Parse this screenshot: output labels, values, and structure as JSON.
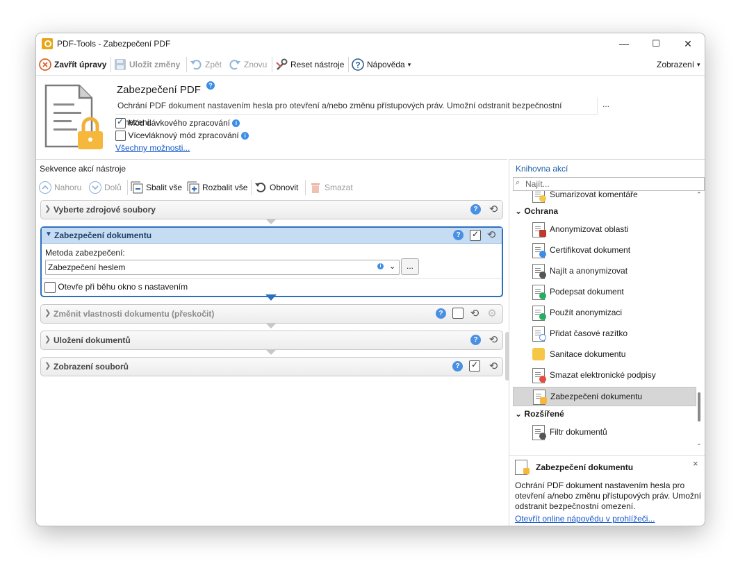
{
  "window": {
    "title": "PDF-Tools - Zabezpečení PDF",
    "min": "—",
    "max": "☐",
    "close": "✕"
  },
  "menubar": {
    "close_edit": "Zavřít úpravy",
    "save": "Uložit změny",
    "undo": "Zpět",
    "redo": "Znovu",
    "reset": "Reset nástroje",
    "help": "Nápověda",
    "view": "Zobrazení"
  },
  "header": {
    "title": "Zabezpečení PDF",
    "description": "Ochrání PDF dokument nastavením hesla pro otevření a/nebo změnu přístupových práv. Umožní odstranit bezpečnostní omezení.",
    "more": "...",
    "batch_mode": {
      "label": "Mód dávkového zpracování",
      "checked": true
    },
    "multithread_mode": {
      "label": "Vícevláknový mód zpracování",
      "checked": false
    },
    "all_options_link": "Všechny možnosti..."
  },
  "sequence": {
    "title": "Sekvence akcí nástroje",
    "toolbar": {
      "up": "Nahoru",
      "down": "Dolů",
      "collapse_all": "Sbalit vše",
      "expand_all": "Rozbalit vše",
      "refresh": "Obnovit",
      "delete": "Smazat"
    },
    "items": [
      {
        "label": "Vyberte zdrojové soubory"
      },
      {
        "label": "Zabezpečení dokumentu",
        "checked": true
      },
      {
        "label": "Změnit vlastnosti dokumentu (přeskočit)",
        "checked": false
      },
      {
        "label": "Uložení dokumentů"
      },
      {
        "label": "Zobrazení souborů",
        "checked": true
      }
    ],
    "expanded": {
      "method_label": "Metoda zabezpečení:",
      "method_value": "Zabezpečení heslem",
      "browse": "...",
      "open_settings_label": "Otevře při běhu okno s nastavením"
    }
  },
  "library": {
    "title": "Knihovna akcí",
    "search_placeholder": "Najít...",
    "items": [
      {
        "label": "Sumarizovat komentáře"
      },
      {
        "group": "Ochrana"
      },
      {
        "label": "Anonymizovat oblasti"
      },
      {
        "label": "Certifikovat dokument"
      },
      {
        "label": "Najít a anonymizovat"
      },
      {
        "label": "Podepsat dokument"
      },
      {
        "label": "Použít anonymizaci"
      },
      {
        "label": "Přidat časové razítko"
      },
      {
        "label": "Sanitace dokumentu"
      },
      {
        "label": "Smazat elektronické podpisy"
      },
      {
        "label": "Zabezpečení dokumentu",
        "selected": true
      },
      {
        "group": "Rozšířené"
      },
      {
        "label": "Filtr dokumentů"
      }
    ],
    "info": {
      "title": "Zabezpečení dokumentu",
      "text": "Ochrání PDF dokument nastavením hesla pro otevření a/nebo změnu přístupových práv. Umožní odstranit bezpečnostní omezení.",
      "link": "Otevřít online nápovědu v prohlížeči...",
      "close": "×"
    }
  }
}
